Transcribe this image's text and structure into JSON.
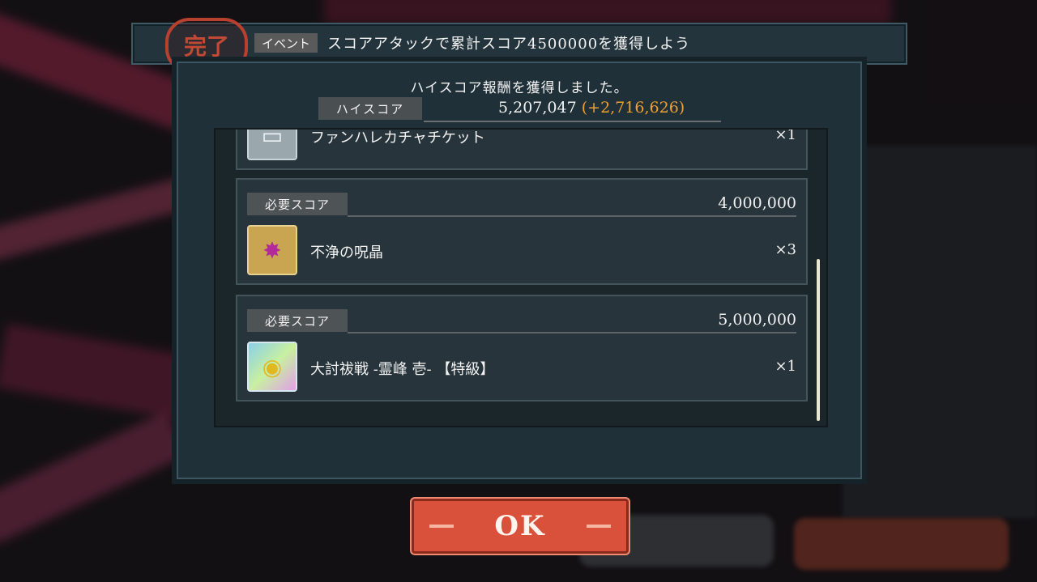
{
  "header": {
    "seal_text": "完了",
    "event_tag": "イベント",
    "title": "スコアアタックで累計スコア4500000を獲得しよう"
  },
  "panel": {
    "subtitle": "ハイスコア報酬を獲得しました。",
    "highscore_label": "ハイスコア",
    "highscore_value": "5,207,047",
    "highscore_diff": "(+2,716,626)"
  },
  "rewards": [
    {
      "item_name": "ファンハレカチャチケット",
      "quantity": "×1",
      "icon": "ticket-icon"
    },
    {
      "required_label": "必要スコア",
      "required_score": "4,000,000",
      "item_name": "不浄の呪晶",
      "quantity": "×3",
      "icon": "crystal-icon"
    },
    {
      "required_label": "必要スコア",
      "required_score": "5,000,000",
      "item_name": "大討祓戦 -霊峰 壱- 【特級】",
      "quantity": "×1",
      "icon": "medal-icon"
    }
  ],
  "ok_button": {
    "label": "OK"
  },
  "colors": {
    "accent": "#f0a030",
    "ok_button": "#d9513b",
    "panel": "#1f3038"
  }
}
